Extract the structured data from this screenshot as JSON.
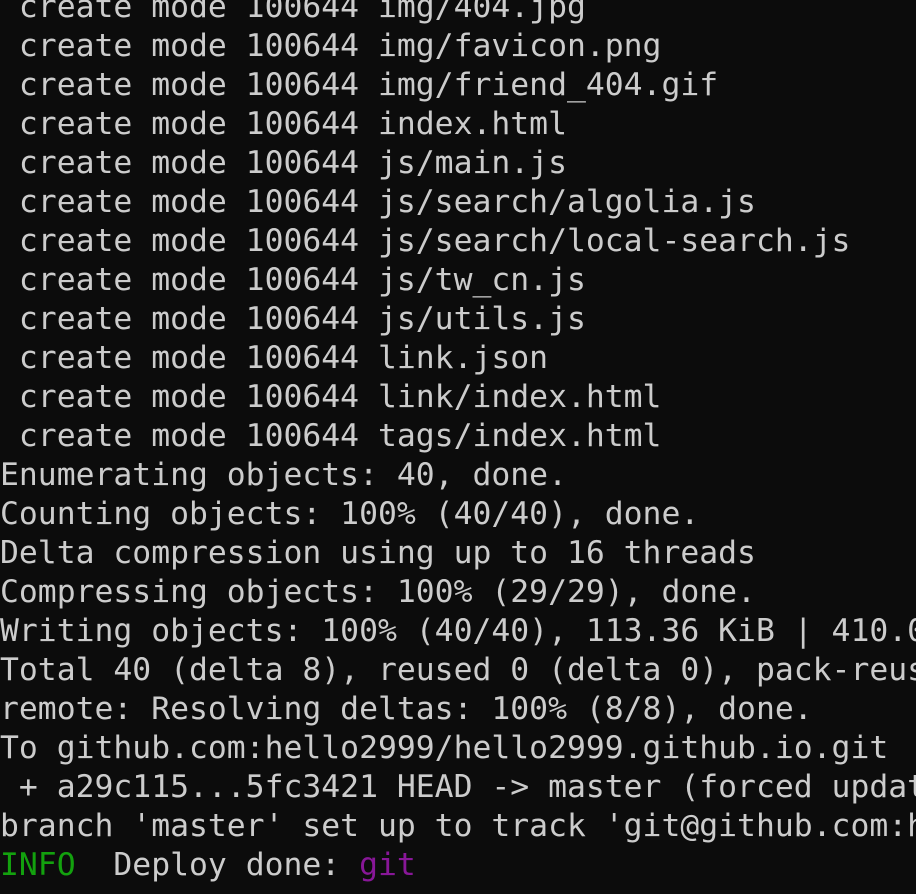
{
  "terminal": {
    "lines": [
      " create mode 100644 img/404.jpg",
      " create mode 100644 img/favicon.png",
      " create mode 100644 img/friend_404.gif",
      " create mode 100644 index.html",
      " create mode 100644 js/main.js",
      " create mode 100644 js/search/algolia.js",
      " create mode 100644 js/search/local-search.js",
      " create mode 100644 js/tw_cn.js",
      " create mode 100644 js/utils.js",
      " create mode 100644 link.json",
      " create mode 100644 link/index.html",
      " create mode 100644 tags/index.html",
      "Enumerating objects: 40, done.",
      "Counting objects: 100% (40/40), done.",
      "Delta compression using up to 16 threads",
      "Compressing objects: 100% (29/29), done.",
      "Writing objects: 100% (40/40), 113.36 KiB | 410.0",
      "Total 40 (delta 8), reused 0 (delta 0), pack-reus",
      "remote: Resolving deltas: 100% (8/8), done.",
      "To github.com:hello2999/hello2999.github.io.git",
      " + a29c115...5fc3421 HEAD -> master (forced updat",
      "branch 'master' set up to track 'git@github.com:h"
    ],
    "info_line": {
      "level": "INFO",
      "message": "  Deploy done: ",
      "target": "git"
    }
  },
  "colors": {
    "background": "#0c0c0c",
    "text": "#cccccc",
    "info": "#13a10e",
    "target": "#881798"
  }
}
